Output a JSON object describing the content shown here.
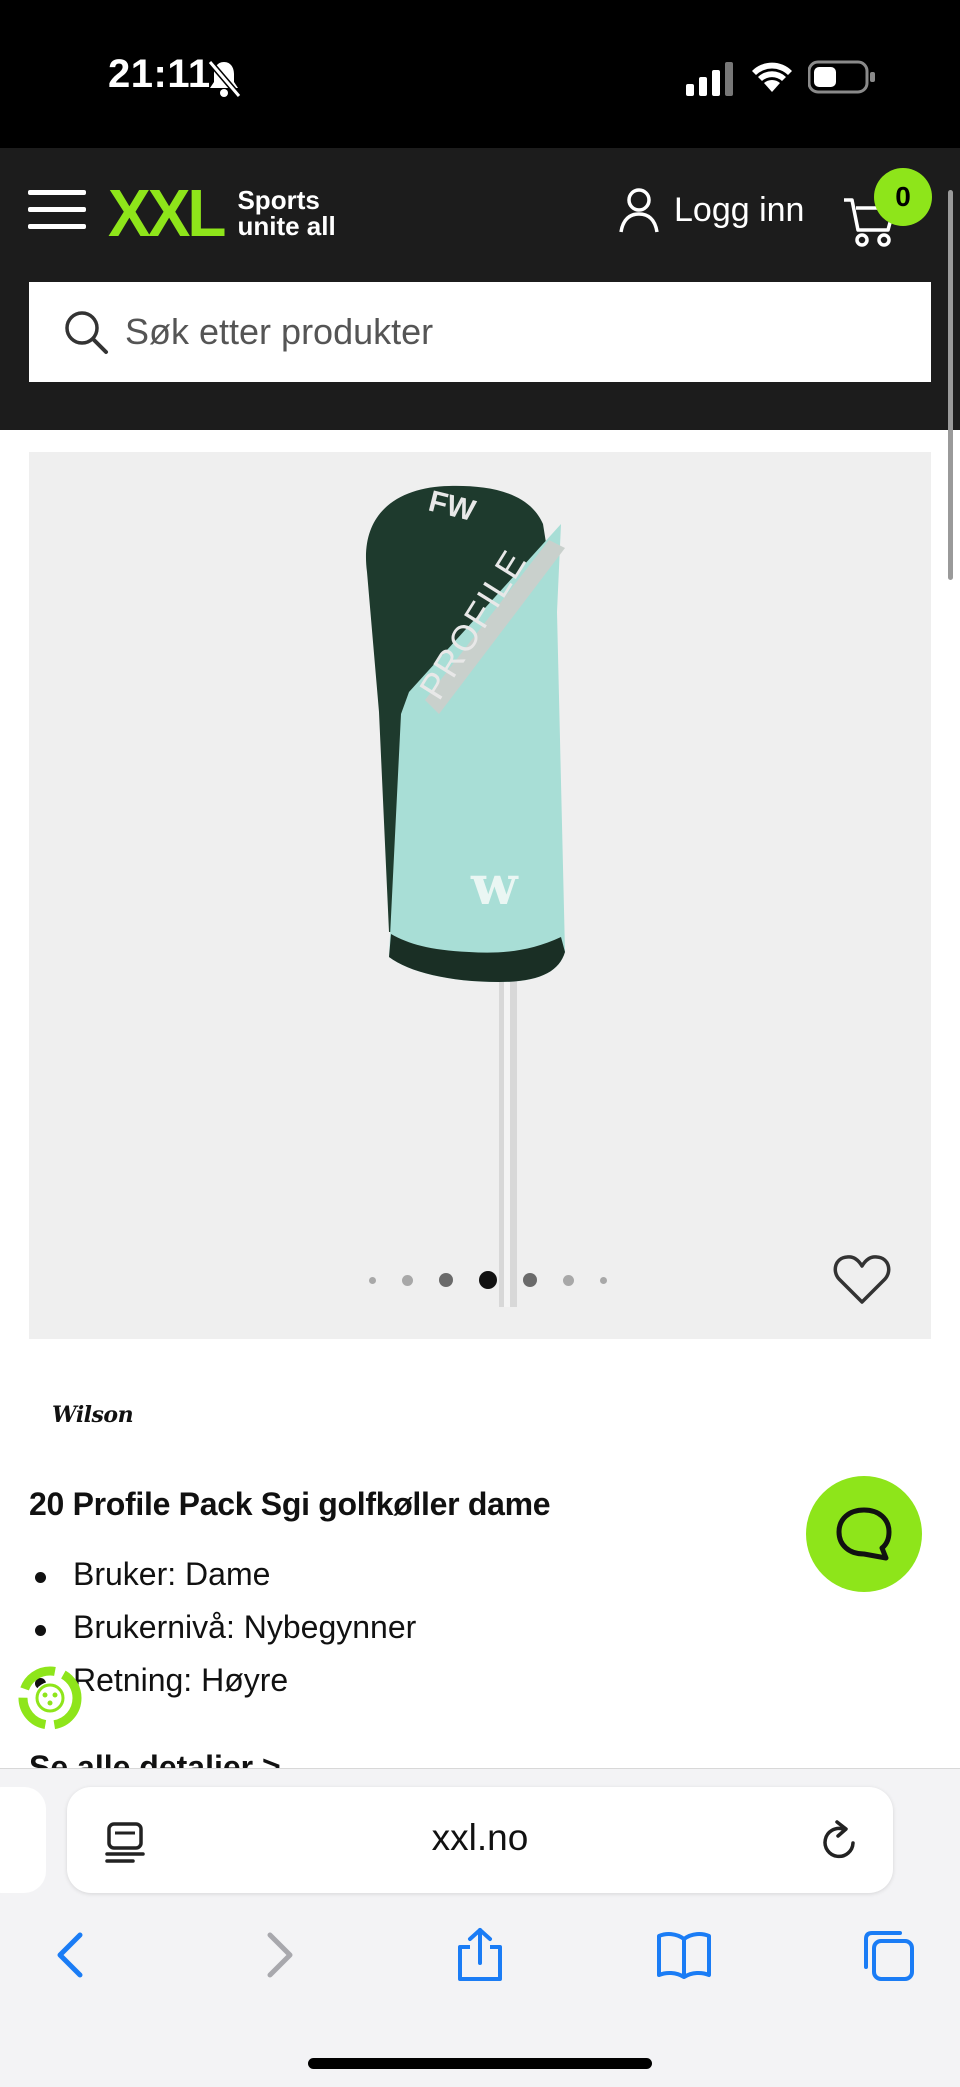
{
  "status_bar": {
    "time": "21:11"
  },
  "header": {
    "logo_text": "XXL",
    "logo_tagline_1": "Sports",
    "logo_tagline_2": "unite all",
    "login_label": "Logg inn",
    "cart_count": "0",
    "search_placeholder": "Søk etter produkter"
  },
  "gallery": {
    "dot_count": 7,
    "active_dot": 3
  },
  "product": {
    "brand": "Wilson",
    "title": "20 Profile Pack Sgi golfkøller dame",
    "specs": [
      "Bruker: Dame",
      "Brukernivå: Nybegynner",
      "Retning: Høyre"
    ],
    "see_all_label": "Se alle detaljer >"
  },
  "browser": {
    "url": "xxl.no"
  },
  "colors": {
    "brand_green": "#8ee51a",
    "header_bg": "#1c1c1c",
    "ios_blue": "#1a7cf5"
  },
  "icons": {
    "menu": "hamburger-menu-icon",
    "user": "user-icon",
    "cart": "shopping-cart-icon",
    "search": "magnifier-icon",
    "wishlist": "heart-icon",
    "chat": "chat-bubble-icon",
    "back": "chevron-left-icon",
    "forward": "chevron-right-icon",
    "share": "share-icon",
    "bookmarks": "book-icon",
    "tabs": "tabs-icon"
  }
}
